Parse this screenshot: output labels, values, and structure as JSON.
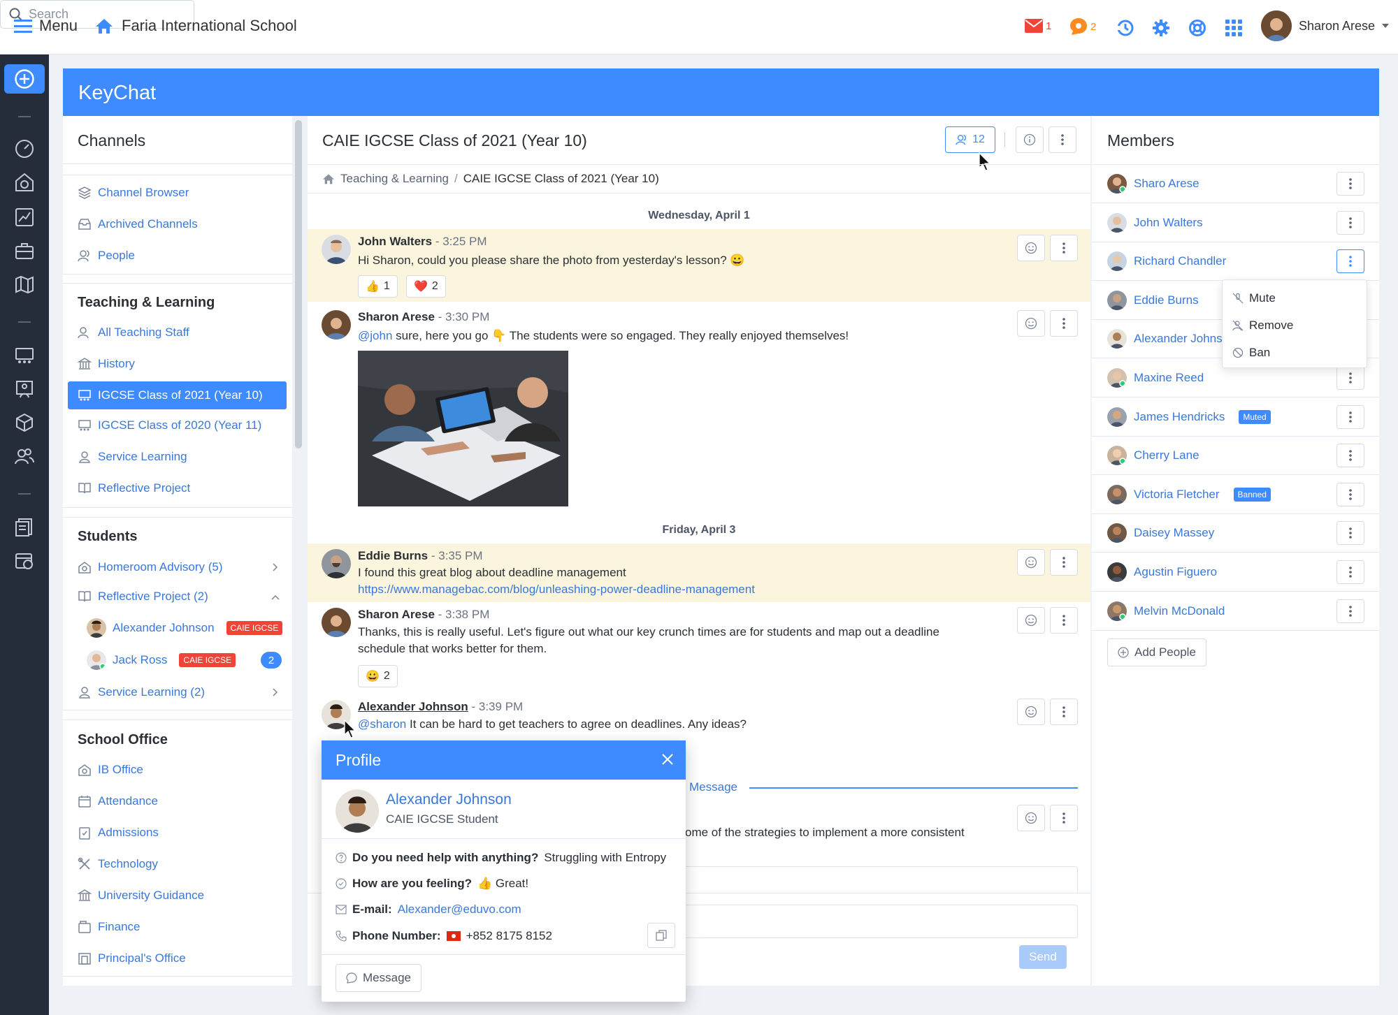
{
  "topbar": {
    "menu_label": "Menu",
    "school_name": "Faria International School",
    "search_placeholder": "Search",
    "mail_count": "1",
    "chat_count": "2",
    "user_name": "Sharon Arese"
  },
  "app": {
    "title": "KeyChat"
  },
  "channels": {
    "title": "Channels",
    "nav": [
      {
        "label": "Channel Browser",
        "icon": "layers-icon"
      },
      {
        "label": "Archived Channels",
        "icon": "archive-icon"
      },
      {
        "label": "People",
        "icon": "people-icon"
      }
    ],
    "teaching": {
      "title": "Teaching & Learning",
      "items": [
        "All Teaching Staff",
        "History",
        "IGCSE Class of 2021 (Year 10)",
        "IGCSE Class of 2020 (Year 11)",
        "Service Learning",
        "Reflective Project"
      ]
    },
    "students": {
      "title": "Students",
      "items": [
        "Homeroom Advisory (5)",
        "Reflective Project (2)",
        "Service Learning (2)"
      ],
      "sub": [
        {
          "name": "Alexander Johnson",
          "tag": "CAIE IGCSE"
        },
        {
          "name": "Jack Ross",
          "tag": "CAIE IGCSE",
          "count": "2"
        }
      ]
    },
    "office": {
      "title": "School Office",
      "items": [
        "IB Office",
        "Attendance",
        "Admissions",
        "Technology",
        "University Guidance",
        "Finance",
        "Principal's Office"
      ]
    }
  },
  "chat": {
    "title": "CAIE IGCSE Class of 2021 (Year 10)",
    "member_count": "12",
    "breadcrumb": {
      "parent": "Teaching & Learning",
      "sep": "/",
      "current": "CAIE IGCSE Class of 2021 (Year 10)"
    },
    "date1": "Wednesday, April 1",
    "date2": "Friday, April 3",
    "messages": [
      {
        "name": "John Walters",
        "time": "- 3:25 PM",
        "text": "Hi Sharon, could you please share the photo from yesterday's lesson? 😀",
        "reactions": [
          {
            "emoji": "👍",
            "count": "1"
          },
          {
            "emoji": "❤️",
            "count": "2"
          }
        ]
      },
      {
        "name": "Sharon Arese",
        "time": "- 3:30 PM",
        "mention": "@john",
        "text": " sure, here you go 👇 The students were so engaged. They really enjoyed themselves!"
      },
      {
        "name": "Eddie Burns",
        "time": "- 3:35 PM",
        "text": "I found this great blog about deadline management",
        "link": "https://www.managebac.com/blog/unleashing-power-deadline-management"
      },
      {
        "name": "Sharon Arese",
        "time": "- 3:38 PM",
        "text": "Thanks, this is really useful. Let's figure out what our key crunch times are for students and map out a deadline schedule that works better for them.",
        "reactions": [
          {
            "emoji": "😀",
            "count": "2"
          }
        ]
      },
      {
        "name": "Alexander Johnson",
        "time": "- 3:39 PM",
        "mention": "@sharon",
        "text": " It can be hard to get teachers to agree on deadlines. Any ideas?"
      }
    ],
    "partial_new": "Message",
    "partial_text": "ome of the strategies to implement a more consistent",
    "send_label": "Send"
  },
  "members": {
    "title": "Members",
    "list": [
      {
        "name": "Sharo Arese",
        "status": ""
      },
      {
        "name": "John Walters",
        "status": ""
      },
      {
        "name": "Richard Chandler",
        "status": ""
      },
      {
        "name": "Eddie Burns",
        "status": ""
      },
      {
        "name": "Alexander Johnson",
        "status": ""
      },
      {
        "name": "Maxine Reed",
        "status": ""
      },
      {
        "name": "James Hendricks",
        "status": "Muted"
      },
      {
        "name": "Cherry Lane",
        "status": ""
      },
      {
        "name": "Victoria Fletcher",
        "status": "Banned"
      },
      {
        "name": "Daisey Massey",
        "status": ""
      },
      {
        "name": "Agustin Figuero",
        "status": ""
      },
      {
        "name": "Melvin McDonald",
        "status": ""
      }
    ],
    "add_label": "Add People",
    "menu": [
      "Mute",
      "Remove",
      "Ban"
    ]
  },
  "profile": {
    "title": "Profile",
    "name": "Alexander Johnson",
    "role": "CAIE IGCSE Student",
    "q1_label": "Do you need help with anything?",
    "q1_value": "Struggling with Entropy",
    "q2_label": "How are you feeling?",
    "q2_value": "👍 Great!",
    "email_label": "E-mail:",
    "email_value": "Alexander@eduvo.com",
    "phone_label": "Phone Number:",
    "phone_value": "+852 8175 8152",
    "message_label": "Message"
  },
  "colors": {
    "accent": "#3d8bff",
    "nav_bg": "#262d3a",
    "link": "#3a78d8",
    "highlight": "#fbf5dd",
    "tag_red": "#f04438"
  }
}
